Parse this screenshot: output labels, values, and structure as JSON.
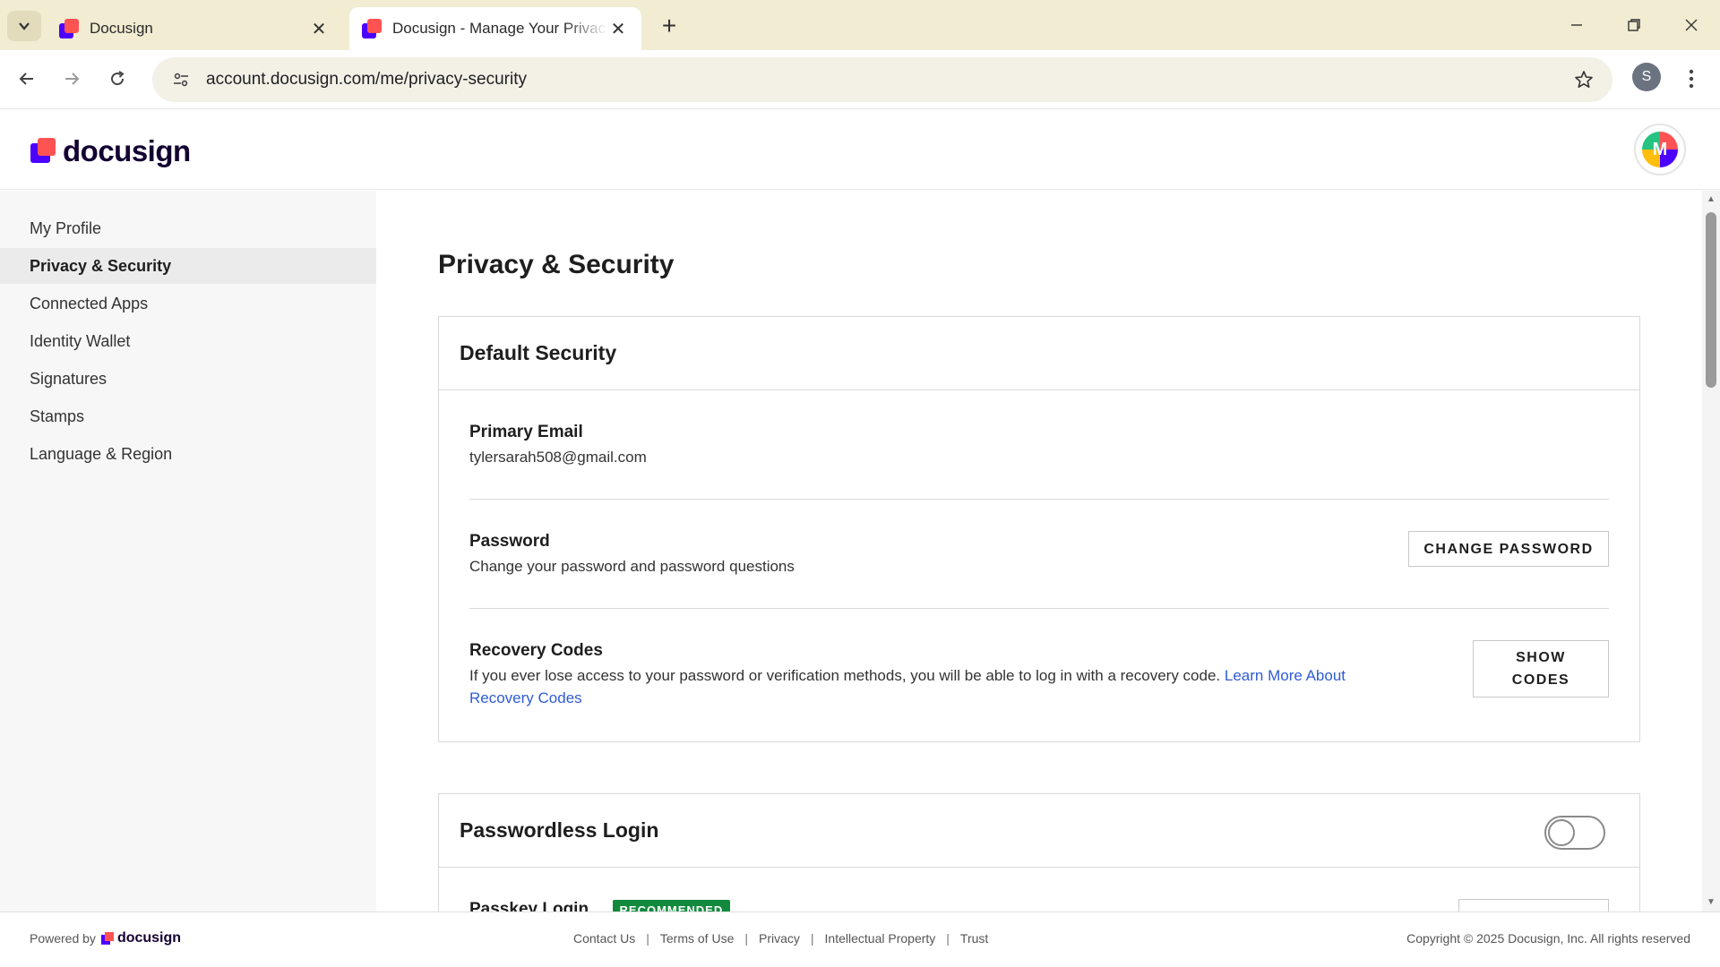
{
  "browser": {
    "tabs": [
      {
        "title": "Docusign",
        "active": false
      },
      {
        "title": "Docusign - Manage Your Privacy",
        "active": true
      }
    ],
    "url": "account.docusign.com/me/privacy-security",
    "profile_initial": "S"
  },
  "header": {
    "logo_text": "docusign",
    "avatar_initial": "M"
  },
  "sidebar": {
    "items": [
      {
        "label": "My Profile",
        "active": false
      },
      {
        "label": "Privacy & Security",
        "active": true
      },
      {
        "label": "Connected Apps",
        "active": false
      },
      {
        "label": "Identity Wallet",
        "active": false
      },
      {
        "label": "Signatures",
        "active": false
      },
      {
        "label": "Stamps",
        "active": false
      },
      {
        "label": "Language & Region",
        "active": false
      }
    ]
  },
  "main": {
    "page_title": "Privacy & Security",
    "default_security": {
      "title": "Default Security",
      "primary_email": {
        "label": "Primary Email",
        "value": "tylersarah508@gmail.com"
      },
      "password": {
        "label": "Password",
        "description": "Change your password and password questions",
        "button": "CHANGE PASSWORD"
      },
      "recovery_codes": {
        "label": "Recovery Codes",
        "description": "If you ever lose access to your password or verification methods, you will be able to log in with a recovery code.",
        "link_text": "Learn More About Recovery Codes",
        "button_line1": "SHOW",
        "button_line2": "CODES"
      }
    },
    "passwordless_login": {
      "title": "Passwordless Login",
      "toggle_on": false,
      "passkey_label": "Passkey Login",
      "badge": "RECOMMENDED"
    }
  },
  "footer": {
    "powered_by": "Powered by",
    "brand": "docusign",
    "links": [
      "Contact Us",
      "Terms of Use",
      "Privacy",
      "Intellectual Property",
      "Trust"
    ],
    "copyright": "Copyright © 2025 Docusign, Inc. All rights reserved"
  },
  "colors": {
    "brand_purple": "#4c00ff",
    "brand_coral": "#ff5252",
    "link": "#2f5bd6",
    "badge_green": "#128a3e"
  }
}
